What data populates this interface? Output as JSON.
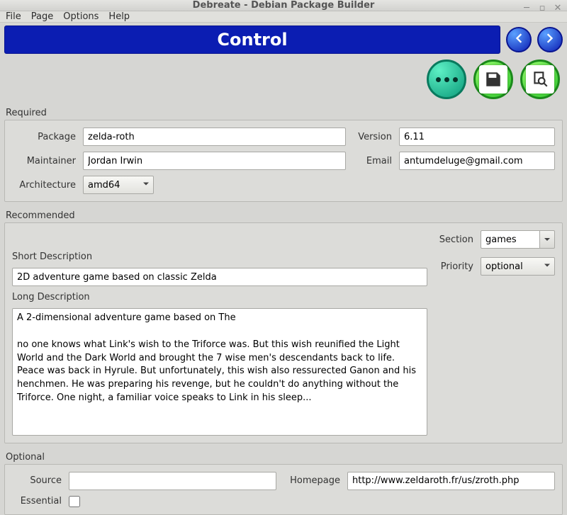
{
  "window": {
    "title": "Debreate - Debian Package Builder"
  },
  "menubar": {
    "file": "File",
    "page": "Page",
    "options": "Options",
    "help": "Help"
  },
  "header": {
    "banner": "Control"
  },
  "required": {
    "legend": "Required",
    "package_label": "Package",
    "package_value": "zelda-roth",
    "version_label": "Version",
    "version_value": "6.11",
    "maintainer_label": "Maintainer",
    "maintainer_value": "Jordan Irwin",
    "email_label": "Email",
    "email_value": "antumdeluge@gmail.com",
    "architecture_label": "Architecture",
    "architecture_value": "amd64"
  },
  "recommended": {
    "legend": "Recommended",
    "short_desc_label": "Short Description",
    "short_desc_value": "2D adventure game based on classic Zelda",
    "long_desc_label": "Long Description",
    "long_desc_value": "A 2-dimensional adventure game based on The\n\nno one knows what Link's wish to the Triforce was. But this wish reunified the Light World and the Dark World and brought the 7 wise men's descendants back to life. Peace was back in Hyrule. But unfortunately, this wish also ressurected Ganon and his henchmen. He was preparing his revenge, but he couldn't do anything without the Triforce. One night, a familiar voice speaks to Link in his sleep...",
    "section_label": "Section",
    "section_value": "games",
    "priority_label": "Priority",
    "priority_value": "optional"
  },
  "optional": {
    "legend": "Optional",
    "source_label": "Source",
    "source_value": "",
    "homepage_label": "Homepage",
    "homepage_value": "http://www.zeldaroth.fr/us/zroth.php",
    "essential_label": "Essential"
  }
}
